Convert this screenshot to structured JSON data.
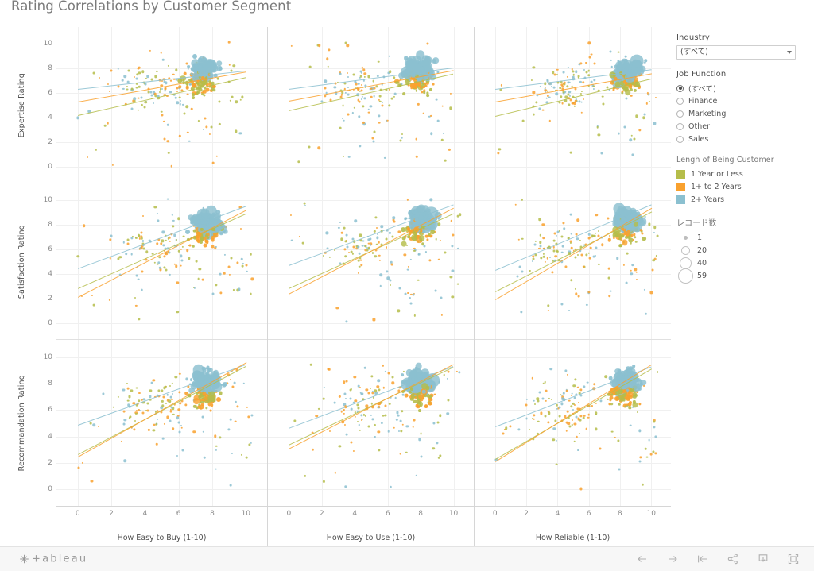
{
  "title": "Rating Correlations by Customer Segment",
  "filters": {
    "industry": {
      "label": "Industry",
      "value": "(すべて)"
    },
    "job_function": {
      "label": "Job Function",
      "selected": "(すべて)",
      "options": [
        "(すべて)",
        "Finance",
        "Marketing",
        "Other",
        "Sales"
      ]
    }
  },
  "color_legend": {
    "title": "Lengh of Being Customer",
    "items": [
      {
        "label": "1 Year or Less",
        "color": "#b5bd4a"
      },
      {
        "label": "1+ to 2 Years",
        "color": "#f9a12e"
      },
      {
        "label": "2+ Years",
        "color": "#8bc0d0"
      }
    ]
  },
  "size_legend": {
    "title": "レコード数",
    "items": [
      {
        "label": "1",
        "size": 3
      },
      {
        "label": "20",
        "size": 9
      },
      {
        "label": "40",
        "size": 13
      },
      {
        "label": "59",
        "size": 17
      }
    ]
  },
  "footer": {
    "brand": "+ableau",
    "icons": [
      "back-icon",
      "forward-icon",
      "revert-icon",
      "share-icon",
      "download-icon",
      "fullscreen-icon"
    ]
  },
  "chart_data": {
    "type": "scatter",
    "title": "Rating Correlations by Customer Segment",
    "grid": true,
    "legend_position": "right",
    "xlim": [
      -0.6,
      10.6
    ],
    "ylim": [
      -0.6,
      10.6
    ],
    "xticks": [
      0,
      2,
      4,
      6,
      8,
      10
    ],
    "yticks": [
      0,
      2,
      4,
      6,
      8,
      10
    ],
    "columns": [
      {
        "xlabel": "How Easy to Buy (1-10)"
      },
      {
        "xlabel": "How Easy to Use (1-10)"
      },
      {
        "xlabel": "How Reliable (1-10)"
      }
    ],
    "rows": [
      {
        "ylabel": "Expertise Rating"
      },
      {
        "ylabel": "Satisfaction Rating"
      },
      {
        "ylabel": "Recommandation Rating"
      }
    ],
    "series_colors": {
      "1 Year or Less": "#b5bd4a",
      "1+ to 2 Years": "#f9a12e",
      "2+ Years": "#8bc0d0"
    },
    "size_encoding": {
      "field": "レコード数",
      "min": 1,
      "max": 59
    },
    "trend_lines": [
      {
        "row": 0,
        "col": 0,
        "series": "2+ Years",
        "x0": 0,
        "y0": 6.35,
        "x1": 10,
        "y1": 7.85
      },
      {
        "row": 0,
        "col": 0,
        "series": "1+ to 2 Years",
        "x0": 0,
        "y0": 5.3,
        "x1": 10,
        "y1": 7.75
      },
      {
        "row": 0,
        "col": 0,
        "series": "1 Year or Less",
        "x0": 0,
        "y0": 4.2,
        "x1": 10,
        "y1": 7.3
      },
      {
        "row": 0,
        "col": 1,
        "series": "2+ Years",
        "x0": 0,
        "y0": 6.3,
        "x1": 10,
        "y1": 8.05
      },
      {
        "row": 0,
        "col": 1,
        "series": "1+ to 2 Years",
        "x0": 0,
        "y0": 5.35,
        "x1": 10,
        "y1": 7.85
      },
      {
        "row": 0,
        "col": 1,
        "series": "1 Year or Less",
        "x0": 0,
        "y0": 4.55,
        "x1": 10,
        "y1": 7.55
      },
      {
        "row": 0,
        "col": 2,
        "series": "2+ Years",
        "x0": 0,
        "y0": 6.35,
        "x1": 10,
        "y1": 7.95
      },
      {
        "row": 0,
        "col": 2,
        "series": "1+ to 2 Years",
        "x0": 0,
        "y0": 5.3,
        "x1": 10,
        "y1": 7.6
      },
      {
        "row": 0,
        "col": 2,
        "series": "1 Year or Less",
        "x0": 0,
        "y0": 4.1,
        "x1": 10,
        "y1": 7.15
      },
      {
        "row": 1,
        "col": 0,
        "series": "2+ Years",
        "x0": 0,
        "y0": 4.45,
        "x1": 10,
        "y1": 9.55
      },
      {
        "row": 1,
        "col": 0,
        "series": "1 Year or Less",
        "x0": 0,
        "y0": 2.8,
        "x1": 10,
        "y1": 8.9
      },
      {
        "row": 1,
        "col": 0,
        "series": "1+ to 2 Years",
        "x0": 0,
        "y0": 2.15,
        "x1": 10,
        "y1": 9.25
      },
      {
        "row": 1,
        "col": 1,
        "series": "2+ Years",
        "x0": 0,
        "y0": 4.7,
        "x1": 10,
        "y1": 9.65
      },
      {
        "row": 1,
        "col": 1,
        "series": "1 Year or Less",
        "x0": 0,
        "y0": 2.85,
        "x1": 10,
        "y1": 8.95
      },
      {
        "row": 1,
        "col": 1,
        "series": "1+ to 2 Years",
        "x0": 0,
        "y0": 2.35,
        "x1": 10,
        "y1": 9.35
      },
      {
        "row": 1,
        "col": 2,
        "series": "2+ Years",
        "x0": 0,
        "y0": 4.35,
        "x1": 10,
        "y1": 9.7
      },
      {
        "row": 1,
        "col": 2,
        "series": "1 Year or Less",
        "x0": 0,
        "y0": 2.55,
        "x1": 10,
        "y1": 9.05
      },
      {
        "row": 1,
        "col": 2,
        "series": "1+ to 2 Years",
        "x0": 0,
        "y0": 1.95,
        "x1": 10,
        "y1": 9.4
      },
      {
        "row": 2,
        "col": 0,
        "series": "2+ Years",
        "x0": 0,
        "y0": 4.85,
        "x1": 10,
        "y1": 9.45
      },
      {
        "row": 2,
        "col": 0,
        "series": "1 Year or Less",
        "x0": 0,
        "y0": 2.65,
        "x1": 10,
        "y1": 9.35
      },
      {
        "row": 2,
        "col": 0,
        "series": "1+ to 2 Years",
        "x0": 0,
        "y0": 2.45,
        "x1": 10,
        "y1": 9.6
      },
      {
        "row": 2,
        "col": 1,
        "series": "2+ Years",
        "x0": 0,
        "y0": 4.65,
        "x1": 10,
        "y1": 9.35
      },
      {
        "row": 2,
        "col": 1,
        "series": "1 Year or Less",
        "x0": 0,
        "y0": 3.35,
        "x1": 10,
        "y1": 9.25
      },
      {
        "row": 2,
        "col": 1,
        "series": "1+ to 2 Years",
        "x0": 0,
        "y0": 3.1,
        "x1": 10,
        "y1": 9.5
      },
      {
        "row": 2,
        "col": 2,
        "series": "2+ Years",
        "x0": 0,
        "y0": 4.75,
        "x1": 10,
        "y1": 9.3
      },
      {
        "row": 2,
        "col": 2,
        "series": "1 Year or Less",
        "x0": 0,
        "y0": 2.3,
        "x1": 10,
        "y1": 9.15
      },
      {
        "row": 2,
        "col": 2,
        "series": "1+ to 2 Years",
        "x0": 0,
        "y0": 2.1,
        "x1": 10,
        "y1": 9.45
      }
    ],
    "cluster_centers": [
      {
        "row": 0,
        "col": 0,
        "x": 7.4,
        "y": 7.9
      },
      {
        "row": 0,
        "col": 1,
        "x": 7.9,
        "y": 8.0
      },
      {
        "row": 0,
        "col": 2,
        "x": 8.5,
        "y": 8.0
      },
      {
        "row": 1,
        "col": 0,
        "x": 7.6,
        "y": 8.3
      },
      {
        "row": 1,
        "col": 1,
        "x": 8.0,
        "y": 8.4
      },
      {
        "row": 1,
        "col": 2,
        "x": 8.5,
        "y": 8.4
      },
      {
        "row": 2,
        "col": 0,
        "x": 7.7,
        "y": 8.2
      },
      {
        "row": 2,
        "col": 1,
        "x": 8.0,
        "y": 8.2
      },
      {
        "row": 2,
        "col": 2,
        "x": 8.4,
        "y": 8.2
      }
    ]
  }
}
